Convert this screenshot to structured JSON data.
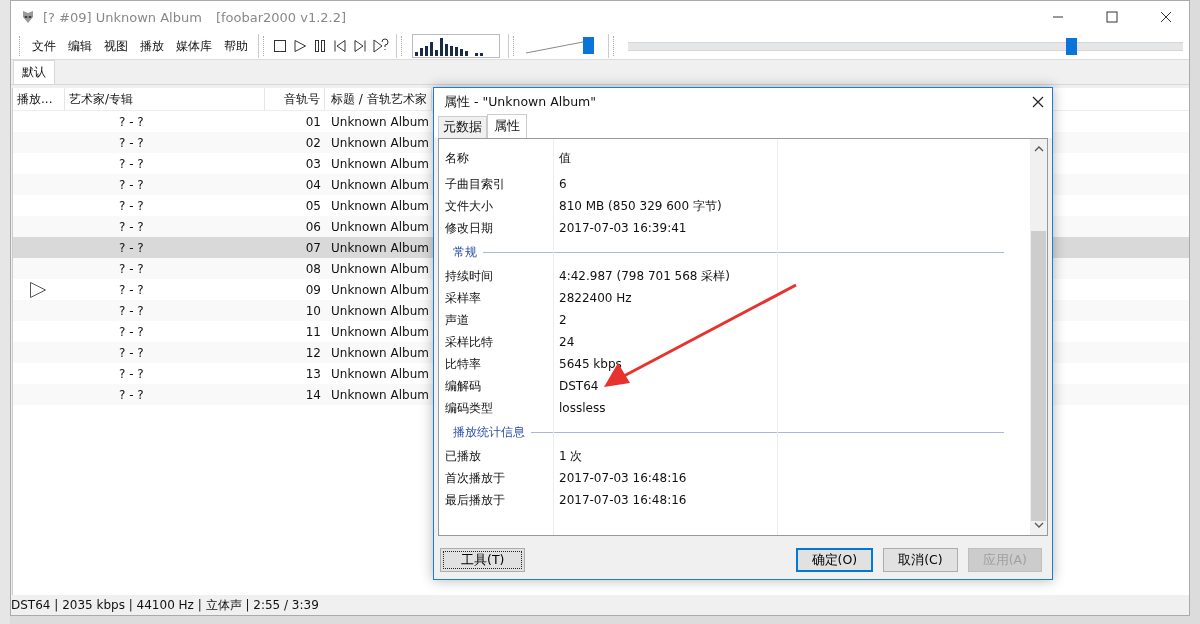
{
  "window": {
    "title": "[? #09] Unknown Album",
    "subtitle": "[foobar2000 v1.2.2]"
  },
  "menu": [
    "文件",
    "编辑",
    "视图",
    "播放",
    "媒体库",
    "帮助"
  ],
  "volume": {
    "level": 0.92
  },
  "seek": {
    "level": 0.8
  },
  "tabs": [
    {
      "label": "默认",
      "selected": true
    }
  ],
  "playlist": {
    "columns": [
      "播放...",
      "艺术家/专辑",
      "音轨号",
      "标题 / 音轨艺术家"
    ],
    "rows": [
      {
        "artist": "? - ?",
        "track": "01",
        "title": "Unknown Album",
        "selected": false,
        "playing": false
      },
      {
        "artist": "? - ?",
        "track": "02",
        "title": "Unknown Album",
        "selected": false,
        "playing": false
      },
      {
        "artist": "? - ?",
        "track": "03",
        "title": "Unknown Album",
        "selected": false,
        "playing": false
      },
      {
        "artist": "? - ?",
        "track": "04",
        "title": "Unknown Album",
        "selected": false,
        "playing": false
      },
      {
        "artist": "? - ?",
        "track": "05",
        "title": "Unknown Album",
        "selected": false,
        "playing": false
      },
      {
        "artist": "? - ?",
        "track": "06",
        "title": "Unknown Album",
        "selected": false,
        "playing": false
      },
      {
        "artist": "? - ?",
        "track": "07",
        "title": "Unknown Album",
        "selected": true,
        "playing": false
      },
      {
        "artist": "? - ?",
        "track": "08",
        "title": "Unknown Album",
        "selected": false,
        "playing": false
      },
      {
        "artist": "? - ?",
        "track": "09",
        "title": "Unknown Album",
        "selected": false,
        "playing": true
      },
      {
        "artist": "? - ?",
        "track": "10",
        "title": "Unknown Album",
        "selected": false,
        "playing": false
      },
      {
        "artist": "? - ?",
        "track": "11",
        "title": "Unknown Album",
        "selected": false,
        "playing": false
      },
      {
        "artist": "? - ?",
        "track": "12",
        "title": "Unknown Album",
        "selected": false,
        "playing": false
      },
      {
        "artist": "? - ?",
        "track": "13",
        "title": "Unknown Album",
        "selected": false,
        "playing": false
      },
      {
        "artist": "? - ?",
        "track": "14",
        "title": "Unknown Album",
        "selected": false,
        "playing": false
      }
    ]
  },
  "status_bar": "DST64 | 2035 kbps | 44100 Hz | 立体声 | 2:55 / 3:39",
  "dialog": {
    "title": "属性 - \"Unknown Album\"",
    "tabs": [
      {
        "label": "元数据",
        "selected": false
      },
      {
        "label": "属性",
        "selected": true
      }
    ],
    "columns": [
      "名称",
      "值"
    ],
    "rows": [
      {
        "kind": "field",
        "name": "子曲目索引",
        "value": "6"
      },
      {
        "kind": "field",
        "name": "文件大小",
        "value": "810 MB (850 329 600 字节)"
      },
      {
        "kind": "field",
        "name": "修改日期",
        "value": "2017-07-03 16:39:41"
      },
      {
        "kind": "section",
        "label": "常规"
      },
      {
        "kind": "field",
        "name": "持续时间",
        "value": "4:42.987 (798 701 568 采样)"
      },
      {
        "kind": "field",
        "name": "采样率",
        "value": "2822400 Hz"
      },
      {
        "kind": "field",
        "name": "声道",
        "value": "2"
      },
      {
        "kind": "field",
        "name": "采样比特",
        "value": "24"
      },
      {
        "kind": "field",
        "name": "比特率",
        "value": "5645 kbps"
      },
      {
        "kind": "field",
        "name": "编解码",
        "value": "DST64"
      },
      {
        "kind": "field",
        "name": "编码类型",
        "value": "lossless"
      },
      {
        "kind": "section",
        "label": "播放统计信息"
      },
      {
        "kind": "field",
        "name": "已播放",
        "value": "1 次"
      },
      {
        "kind": "field",
        "name": "首次播放于",
        "value": "2017-07-03 16:48:16"
      },
      {
        "kind": "field",
        "name": "最后播放于",
        "value": "2017-07-03 16:48:16"
      }
    ],
    "tool_button": {
      "label": "工具(T)",
      "focused": true
    },
    "buttons": [
      {
        "label": "确定(O)",
        "default": true,
        "disabled": false
      },
      {
        "label": "取消(C)",
        "default": false,
        "disabled": false
      },
      {
        "label": "应用(A)",
        "default": false,
        "disabled": true
      }
    ]
  }
}
